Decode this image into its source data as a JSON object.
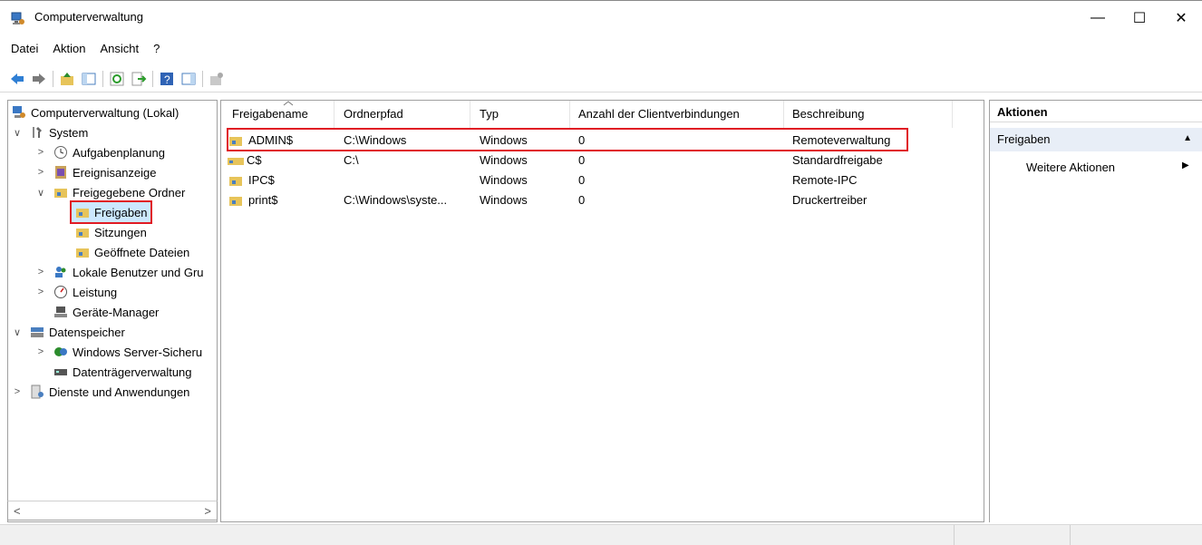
{
  "window": {
    "title": "Computerverwaltung",
    "controls": {
      "minimize": "—",
      "maximize": "☐",
      "close": "✕"
    }
  },
  "menu": {
    "items": [
      {
        "label": "Datei"
      },
      {
        "label": "Aktion"
      },
      {
        "label": "Ansicht"
      },
      {
        "label": "?"
      }
    ]
  },
  "toolbar": {
    "icons": [
      "back-icon",
      "forward-icon",
      "up-folder-icon",
      "show-hide-tree-icon",
      "refresh-icon",
      "export-list-icon",
      "help-icon",
      "show-hide-action-pane-icon",
      "new-share-icon"
    ]
  },
  "tree": {
    "items": [
      {
        "label": "Computerverwaltung (Lokal)",
        "icon": "computer-management-icon"
      },
      {
        "label": "System",
        "icon": "tools-icon",
        "chevron": "∨"
      },
      {
        "label": "Aufgabenplanung",
        "icon": "clock-icon",
        "chevron": ">"
      },
      {
        "label": "Ereignisanzeige",
        "icon": "event-viewer-icon",
        "chevron": ">"
      },
      {
        "label": "Freigegebene Ordner",
        "icon": "shared-folder-icon",
        "chevron": "∨"
      },
      {
        "label": "Freigaben",
        "icon": "shares-icon"
      },
      {
        "label": "Sitzungen",
        "icon": "sessions-icon"
      },
      {
        "label": "Geöffnete Dateien",
        "icon": "open-files-icon"
      },
      {
        "label": "Lokale Benutzer und Gru",
        "icon": "users-icon",
        "chevron": ">"
      },
      {
        "label": "Leistung",
        "icon": "performance-icon",
        "chevron": ">"
      },
      {
        "label": "Geräte-Manager",
        "icon": "device-manager-icon"
      },
      {
        "label": "Datenspeicher",
        "icon": "storage-icon",
        "chevron": "∨"
      },
      {
        "label": "Windows Server-Sicheru",
        "icon": "backup-icon",
        "chevron": ">"
      },
      {
        "label": "Datenträgerverwaltung",
        "icon": "disk-management-icon"
      },
      {
        "label": "Dienste und Anwendungen",
        "icon": "services-icon",
        "chevron": ">"
      }
    ],
    "scroll_left": "<",
    "scroll_right": ">"
  },
  "list": {
    "columns": [
      "Freigabename",
      "Ordnerpfad",
      "Typ",
      "Anzahl der Clientverbindungen",
      "Beschreibung"
    ],
    "rows": [
      {
        "name": "ADMIN$",
        "path": "C:\\Windows",
        "type": "Windows",
        "connections": "0",
        "description": "Remoteverwaltung"
      },
      {
        "name": "C$",
        "path": "C:\\",
        "type": "Windows",
        "connections": "0",
        "description": "Standardfreigabe"
      },
      {
        "name": "IPC$",
        "path": "",
        "type": "Windows",
        "connections": "0",
        "description": "Remote-IPC"
      },
      {
        "name": "print$",
        "path": "C:\\Windows\\syste...",
        "type": "Windows",
        "connections": "0",
        "description": "Druckertreiber"
      }
    ]
  },
  "actions": {
    "title": "Aktionen",
    "section": "Freigaben",
    "section_arrow": "▲",
    "item": "Weitere Aktionen",
    "item_arrow": "▶"
  },
  "colors": {
    "highlight": "#e01b24",
    "action_section_bg": "#e8eef7"
  }
}
